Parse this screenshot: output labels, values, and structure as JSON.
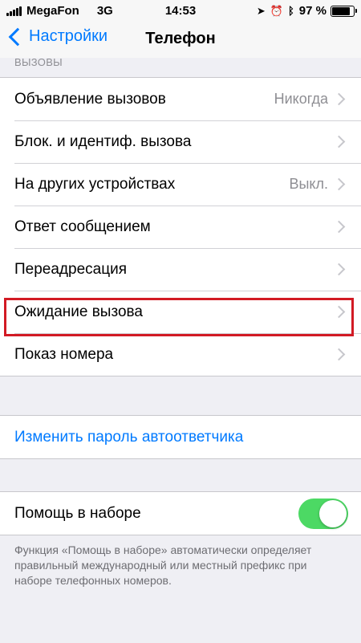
{
  "status_bar": {
    "carrier": "MegaFon",
    "network": "3G",
    "time": "14:53",
    "battery": "97 %",
    "battery_level": 0.97,
    "icons": [
      "location-arrow-icon",
      "alarm-icon",
      "bluetooth-icon"
    ]
  },
  "nav": {
    "back_label": "Настройки",
    "title": "Телефон"
  },
  "calls_section": {
    "header": "ВЫЗОВЫ",
    "rows": [
      {
        "label": "Объявление вызовов",
        "value": "Никогда"
      },
      {
        "label": "Блок. и идентиф. вызова",
        "value": ""
      },
      {
        "label": "На других устройствах",
        "value": "Выкл."
      },
      {
        "label": "Ответ сообщением",
        "value": ""
      },
      {
        "label": "Переадресация",
        "value": ""
      },
      {
        "label": "Ожидание вызова",
        "value": ""
      },
      {
        "label": "Показ номера",
        "value": ""
      }
    ]
  },
  "voicemail": {
    "change_password_label": "Изменить пароль автоответчика"
  },
  "dial_assist": {
    "label": "Помощь в наборе",
    "enabled": true,
    "description": "Функция «Помощь в наборе» автоматически определяет правильный международный или местный префикс при наборе телефонных номеров."
  },
  "colors": {
    "accent": "#007aff",
    "toggle_on": "#4cd964",
    "highlight": "#d21a24"
  }
}
